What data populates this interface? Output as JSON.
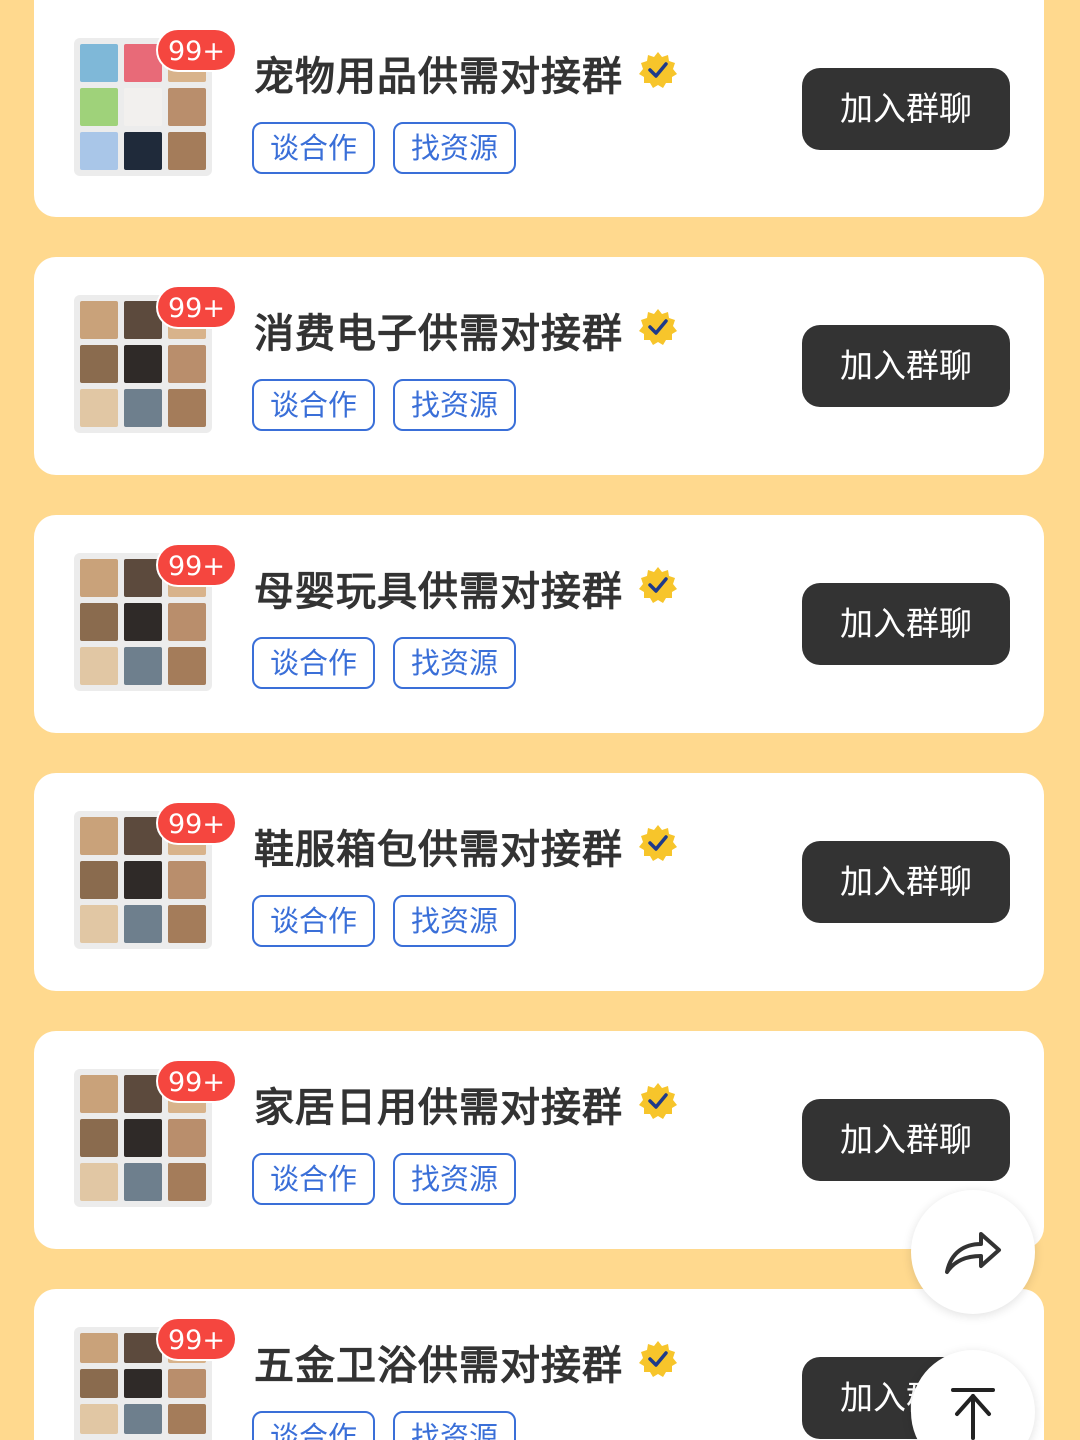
{
  "groups": [
    {
      "title": "宠物用品供需对接群",
      "badge": "99+",
      "tags": [
        "谈合作",
        "找资源"
      ],
      "button": "加入群聊"
    },
    {
      "title": "消费电子供需对接群",
      "badge": "99+",
      "tags": [
        "谈合作",
        "找资源"
      ],
      "button": "加入群聊"
    },
    {
      "title": "母婴玩具供需对接群",
      "badge": "99+",
      "tags": [
        "谈合作",
        "找资源"
      ],
      "button": "加入群聊"
    },
    {
      "title": "鞋服箱包供需对接群",
      "badge": "99+",
      "tags": [
        "谈合作",
        "找资源"
      ],
      "button": "加入群聊"
    },
    {
      "title": "家居日用供需对接群",
      "badge": "99+",
      "tags": [
        "谈合作",
        "找资源"
      ],
      "button": "加入群聊"
    },
    {
      "title": "五金卫浴供需对接群",
      "badge": "99+",
      "tags": [
        "谈合作",
        "找资源"
      ],
      "button": "加入群聊"
    }
  ],
  "floating": {
    "share_icon": "share-arrow-icon",
    "top_icon": "back-to-top-icon"
  },
  "colors": {
    "background": "#FFD98E",
    "button": "#333333",
    "tag": "#3A6FD8",
    "badge": "#F5463F",
    "verified": "#F7C52B"
  }
}
